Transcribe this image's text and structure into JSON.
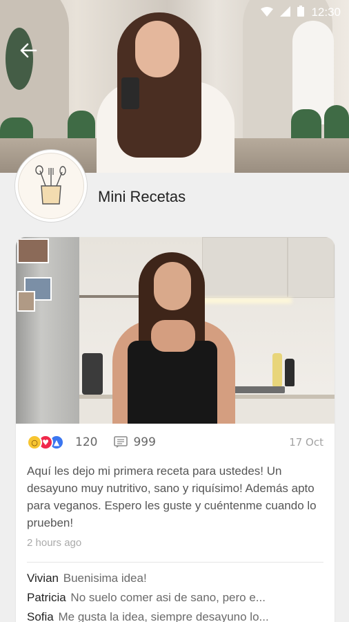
{
  "status_bar": {
    "time": "12:30",
    "icons": [
      "wifi-icon",
      "signal-icon",
      "battery-icon"
    ]
  },
  "header": {
    "back_icon": "arrow-left-icon"
  },
  "profile": {
    "name": "Mini Recetas",
    "avatar_icon": "kitchen-utensils-icon"
  },
  "post": {
    "reactions": {
      "types": [
        "wow",
        "love",
        "like"
      ],
      "count": "120"
    },
    "comments_count": "999",
    "date": "17 Oct",
    "text": "Aquí les dejo mi primera receta para ustedes! Un desayuno muy nutritivo, sano y riquísimo! Además apto para veganos. Espero les guste y cuéntenme cuando lo prueben!",
    "time_ago": "2 hours ago",
    "comments": [
      {
        "author": "Vivian",
        "text": "Buenisima idea!"
      },
      {
        "author": "Patricia",
        "text": "No suelo comer asi de sano, pero e..."
      },
      {
        "author": "Sofia",
        "text": "Me gusta la idea, siempre desayuno lo..."
      }
    ]
  },
  "colors": {
    "background": "#efefef",
    "card": "#ffffff",
    "like_blue": "#3b76f0",
    "love_red": "#f0294b",
    "wow_yellow": "#f7c531"
  }
}
